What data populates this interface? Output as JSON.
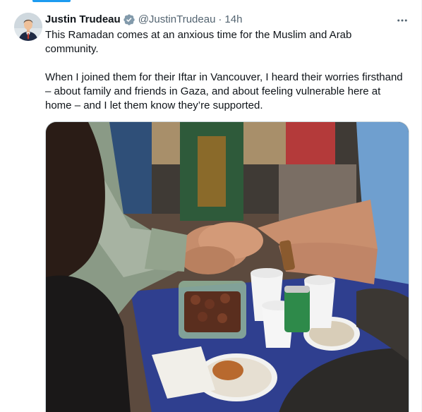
{
  "tweet": {
    "author_name": "Justin Trudeau",
    "handle": "@JustinTrudeau",
    "separator": "·",
    "time": "14h",
    "text_p1": "This Ramadan comes at an anxious time for the Muslim and Arab community.",
    "text_p2": "When I joined them for their Iftar in Vancouver, I heard their worries firsthand – about family and friends in Gaza, and about feeling vulnerable here at home – and I let them know they’re supported."
  },
  "icons": {
    "verified": "verified-badge-icon",
    "more": "more-horizontal-icon"
  },
  "colors": {
    "accent": "#1d9bf0",
    "text_primary": "#0f1419",
    "text_secondary": "#536471",
    "border": "#cfd9de"
  }
}
